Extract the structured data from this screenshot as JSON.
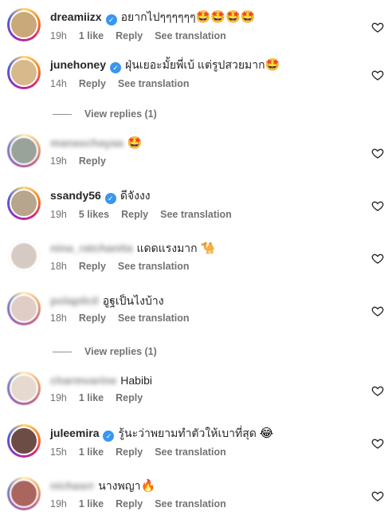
{
  "comments": [
    {
      "username": "dreamiizx",
      "verified": true,
      "blurred": false,
      "text": "อยากไปๆๆๆๆๆๆ",
      "emoji": "🤩🤩🤩🤩",
      "time": "19h",
      "likes": "1 like",
      "reply": "Reply",
      "translate": "See translation",
      "avatar": "#c9a87a"
    },
    {
      "username": "junehoney",
      "verified": true,
      "blurred": false,
      "text": "ฝุ่นเยอะมั้ยพี่เบ้ แต่รูปสวยมาก",
      "emoji": "🤩",
      "time": "14h",
      "likes": "",
      "reply": "Reply",
      "translate": "See translation",
      "avatar": "#d8b98c"
    },
    {
      "username": "manaschayaa",
      "verified": false,
      "blurred": true,
      "text": "",
      "emoji": "🤩",
      "time": "19h",
      "likes": "",
      "reply": "Reply",
      "translate": "",
      "avatar": "#7a8a7a"
    },
    {
      "username": "ssandy56",
      "verified": true,
      "blurred": false,
      "text": "ดีจังงง",
      "emoji": "",
      "time": "19h",
      "likes": "5 likes",
      "reply": "Reply",
      "translate": "See translation",
      "avatar": "#b7a58e"
    },
    {
      "username": "nina_ratchanita",
      "verified": false,
      "blurred": true,
      "text": "แดดแรงมาก",
      "emoji": "🐪",
      "time": "18h",
      "likes": "",
      "reply": "Reply",
      "translate": "See translation",
      "avatar": "#c8b3a6"
    },
    {
      "username": "polapilcil",
      "verified": false,
      "blurred": true,
      "text": "อูฐเป็นไงบ้าง",
      "emoji": "",
      "time": "18h",
      "likes": "",
      "reply": "Reply",
      "translate": "See translation",
      "avatar": "#d4b4a8"
    },
    {
      "username": "charmvarine",
      "verified": false,
      "blurred": true,
      "text": "Habibi",
      "emoji": "",
      "time": "19h",
      "likes": "1 like",
      "reply": "Reply",
      "translate": "",
      "avatar": "#d9c3b0"
    },
    {
      "username": "juleemira",
      "verified": true,
      "blurred": false,
      "text": "รู้นะว่าพยามทำตัวให้เบาที่สุด",
      "emoji": "😂",
      "time": "15h",
      "likes": "1 like",
      "reply": "Reply",
      "translate": "See translation",
      "avatar": "#6d4c46"
    },
    {
      "username": "nichasrr",
      "verified": false,
      "blurred": true,
      "text": "นางพญา",
      "emoji": "🔥",
      "time": "19h",
      "likes": "1 like",
      "reply": "Reply",
      "translate": "See translation",
      "avatar": "#b83b2f"
    }
  ],
  "view_replies": [
    "View replies (1)",
    "View replies (1)"
  ]
}
